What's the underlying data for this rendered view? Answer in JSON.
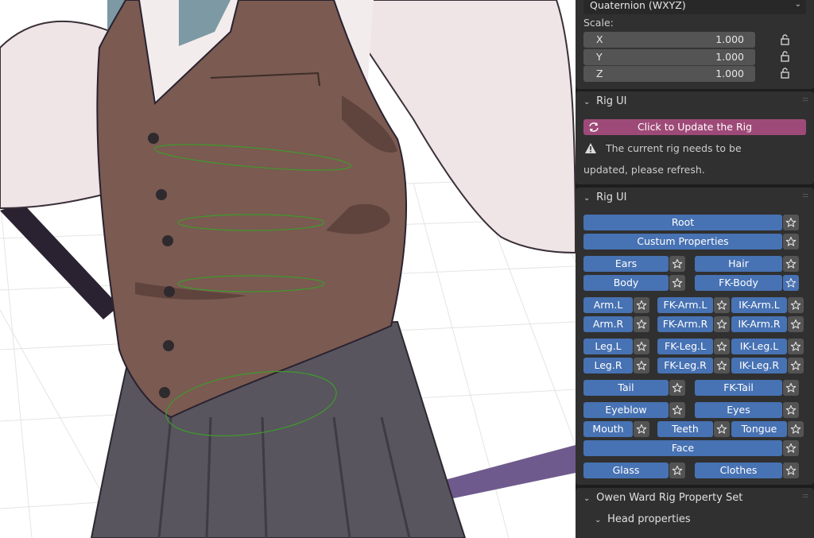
{
  "properties": {
    "rotation_mode": "Quaternion (WXYZ)",
    "scale_label": "Scale:",
    "scale": [
      {
        "axis": "X",
        "value": "1.000"
      },
      {
        "axis": "Y",
        "value": "1.000"
      },
      {
        "axis": "Z",
        "value": "1.000"
      }
    ]
  },
  "rig_ui_update": {
    "title": "Rig UI",
    "button_label": "Click to Update the Rig",
    "warning_line1": "The current rig needs to be",
    "warning_line2": "updated, please refresh."
  },
  "rig_ui_layers": {
    "title": "Rig UI",
    "rows": [
      {
        "buttons": [
          {
            "label": "Root",
            "star": false
          }
        ]
      },
      {
        "buttons": [
          {
            "label": "Custum Properties",
            "star": false
          }
        ]
      },
      {
        "buttons": [
          {
            "label": "Ears",
            "star": false
          },
          {
            "label": "Hair",
            "star": false
          }
        ]
      },
      {
        "buttons": [
          {
            "label": "Body",
            "star": false
          },
          {
            "label": "FK-Body",
            "star": true
          }
        ]
      },
      {
        "buttons": [
          {
            "label": "Arm.L",
            "star": false
          },
          {
            "label": "FK-Arm.L",
            "star": false
          },
          {
            "label": "IK-Arm.L",
            "star": false
          }
        ]
      },
      {
        "buttons": [
          {
            "label": "Arm.R",
            "star": false
          },
          {
            "label": "FK-Arm.R",
            "star": false
          },
          {
            "label": "IK-Arm.R",
            "star": false
          }
        ]
      },
      {
        "buttons": [
          {
            "label": "Leg.L",
            "star": false
          },
          {
            "label": "FK-Leg.L",
            "star": false
          },
          {
            "label": "IK-Leg.L",
            "star": false
          }
        ]
      },
      {
        "buttons": [
          {
            "label": "Leg.R",
            "star": false
          },
          {
            "label": "FK-Leg.R",
            "star": false
          },
          {
            "label": "IK-Leg.R",
            "star": false
          }
        ]
      },
      {
        "buttons": [
          {
            "label": "Tail",
            "star": false
          },
          {
            "label": "FK-Tail",
            "star": false
          }
        ]
      },
      {
        "buttons": [
          {
            "label": "Eyeblow",
            "star": false
          },
          {
            "label": "Eyes",
            "star": false
          }
        ]
      },
      {
        "buttons": [
          {
            "label": "Mouth",
            "star": false
          },
          {
            "label": "Teeth",
            "star": false
          },
          {
            "label": "Tongue",
            "star": false
          }
        ]
      },
      {
        "buttons": [
          {
            "label": "Face",
            "star": false
          }
        ]
      },
      {
        "buttons": [
          {
            "label": "Glass",
            "star": false
          },
          {
            "label": "Clothes",
            "star": false
          }
        ]
      }
    ]
  },
  "property_set": {
    "title": "Owen Ward Rig Property Set",
    "subpanel": "Head properties"
  },
  "colors": {
    "panel": "#303030",
    "button_blue": "#4772b3",
    "update_button": "#9e4a78",
    "field": "#545454"
  }
}
